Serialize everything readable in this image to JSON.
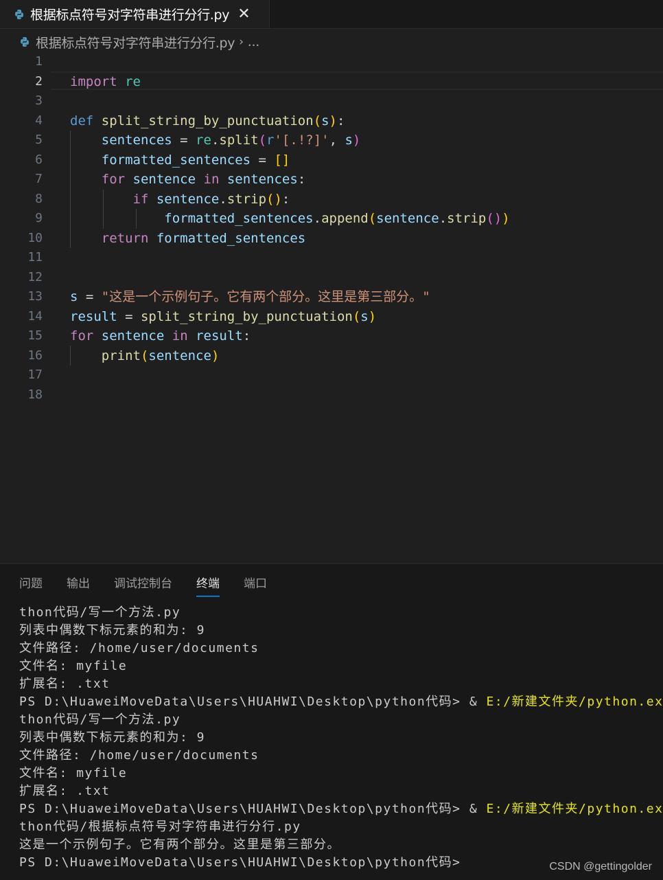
{
  "tab": {
    "title": "根据标点符号对字符串进行分行.py",
    "close": "✕",
    "icon": "python-icon"
  },
  "breadcrumb": {
    "file": "根据标点符号对字符串进行分行.py",
    "separator": "›",
    "ellipsis": "..."
  },
  "editor": {
    "line_numbers": [
      "1",
      "2",
      "3",
      "4",
      "5",
      "6",
      "7",
      "8",
      "9",
      "10",
      "11",
      "12",
      "13",
      "14",
      "15",
      "16",
      "17",
      "18"
    ],
    "active_line": "2",
    "lines": [
      [],
      [
        {
          "t": "import",
          "c": "kw2"
        },
        {
          "t": " "
        },
        {
          "t": "re",
          "c": "mod"
        }
      ],
      [],
      [
        {
          "t": "def",
          "c": "kw"
        },
        {
          "t": " "
        },
        {
          "t": "split_string_by_punctuation",
          "c": "fn"
        },
        {
          "t": "(",
          "c": "br1"
        },
        {
          "t": "s",
          "c": "var"
        },
        {
          "t": ")",
          "c": "br1"
        },
        {
          "t": ":"
        }
      ],
      [
        {
          "t": "    "
        },
        {
          "t": "sentences",
          "c": "var"
        },
        {
          "t": " = "
        },
        {
          "t": "re",
          "c": "mod"
        },
        {
          "t": "."
        },
        {
          "t": "split",
          "c": "fn"
        },
        {
          "t": "(",
          "c": "br2"
        },
        {
          "t": "r",
          "c": "kw"
        },
        {
          "t": "'[.!?]'",
          "c": "str"
        },
        {
          "t": ", "
        },
        {
          "t": "s",
          "c": "var"
        },
        {
          "t": ")",
          "c": "br2"
        }
      ],
      [
        {
          "t": "    "
        },
        {
          "t": "formatted_sentences",
          "c": "var"
        },
        {
          "t": " = "
        },
        {
          "t": "[]",
          "c": "br1"
        }
      ],
      [
        {
          "t": "    "
        },
        {
          "t": "for",
          "c": "kw2"
        },
        {
          "t": " "
        },
        {
          "t": "sentence",
          "c": "var"
        },
        {
          "t": " "
        },
        {
          "t": "in",
          "c": "kw2"
        },
        {
          "t": " "
        },
        {
          "t": "sentences",
          "c": "var"
        },
        {
          "t": ":"
        }
      ],
      [
        {
          "t": "        "
        },
        {
          "t": "if",
          "c": "kw2"
        },
        {
          "t": " "
        },
        {
          "t": "sentence",
          "c": "var"
        },
        {
          "t": "."
        },
        {
          "t": "strip",
          "c": "fn"
        },
        {
          "t": "()",
          "c": "br1"
        },
        {
          "t": ":"
        }
      ],
      [
        {
          "t": "            "
        },
        {
          "t": "formatted_sentences",
          "c": "var"
        },
        {
          "t": "."
        },
        {
          "t": "append",
          "c": "fn"
        },
        {
          "t": "(",
          "c": "br1"
        },
        {
          "t": "sentence",
          "c": "var"
        },
        {
          "t": "."
        },
        {
          "t": "strip",
          "c": "fn"
        },
        {
          "t": "()",
          "c": "br2"
        },
        {
          "t": ")",
          "c": "br1"
        }
      ],
      [
        {
          "t": "    "
        },
        {
          "t": "return",
          "c": "kw2"
        },
        {
          "t": " "
        },
        {
          "t": "formatted_sentences",
          "c": "var"
        }
      ],
      [],
      [],
      [
        {
          "t": "s",
          "c": "var"
        },
        {
          "t": " = "
        },
        {
          "t": "\"这是一个示例句子。它有两个部分。这里是第三部分。\"",
          "c": "str"
        }
      ],
      [
        {
          "t": "result",
          "c": "var"
        },
        {
          "t": " = "
        },
        {
          "t": "split_string_by_punctuation",
          "c": "fn"
        },
        {
          "t": "(",
          "c": "br1"
        },
        {
          "t": "s",
          "c": "var"
        },
        {
          "t": ")",
          "c": "br1"
        }
      ],
      [
        {
          "t": "for",
          "c": "kw2"
        },
        {
          "t": " "
        },
        {
          "t": "sentence",
          "c": "var"
        },
        {
          "t": " "
        },
        {
          "t": "in",
          "c": "kw2"
        },
        {
          "t": " "
        },
        {
          "t": "result",
          "c": "var"
        },
        {
          "t": ":"
        }
      ],
      [
        {
          "t": "    "
        },
        {
          "t": "print",
          "c": "fn"
        },
        {
          "t": "(",
          "c": "br1"
        },
        {
          "t": "sentence",
          "c": "var"
        },
        {
          "t": ")",
          "c": "br1"
        }
      ],
      [],
      []
    ]
  },
  "panel": {
    "tabs": [
      "问题",
      "输出",
      "调试控制台",
      "终端",
      "端口"
    ],
    "active_tab": "终端",
    "terminal_lines": [
      [
        {
          "t": "thon代码/写一个方法.py"
        }
      ],
      [
        {
          "t": "列表中偶数下标元素的和为: 9"
        }
      ],
      [
        {
          "t": "文件路径: /home/user/documents"
        }
      ],
      [
        {
          "t": "文件名: myfile"
        }
      ],
      [
        {
          "t": "扩展名: .txt"
        }
      ],
      [
        {
          "t": "PS D:\\HuaweiMoveData\\Users\\HUAHWI\\Desktop\\python代码> & "
        },
        {
          "t": "E:/新建文件夹/python.exe",
          "c": "y"
        }
      ],
      [
        {
          "t": "thon代码/写一个方法.py"
        }
      ],
      [
        {
          "t": "列表中偶数下标元素的和为: 9"
        }
      ],
      [
        {
          "t": "文件路径: /home/user/documents"
        }
      ],
      [
        {
          "t": "文件名: myfile"
        }
      ],
      [
        {
          "t": "扩展名: .txt"
        }
      ],
      [
        {
          "t": "PS D:\\HuaweiMoveData\\Users\\HUAHWI\\Desktop\\python代码> & "
        },
        {
          "t": "E:/新建文件夹/python.exe",
          "c": "y"
        }
      ],
      [
        {
          "t": "thon代码/根据标点符号对字符串进行分行.py"
        }
      ],
      [
        {
          "t": "这是一个示例句子。它有两个部分。这里是第三部分。"
        }
      ],
      [
        {
          "t": "PS D:\\HuaweiMoveData\\Users\\HUAHWI\\Desktop\\python代码>"
        }
      ]
    ]
  },
  "watermark": "CSDN @gettingolder",
  "colors": {
    "editor_bg": "#1f1f1f",
    "panel_bg": "#181818",
    "accent": "#0078d4",
    "keyword": "#569cd6",
    "control": "#c586c0",
    "function": "#dcdcaa",
    "variable": "#9cdcfe",
    "string": "#ce9178"
  }
}
